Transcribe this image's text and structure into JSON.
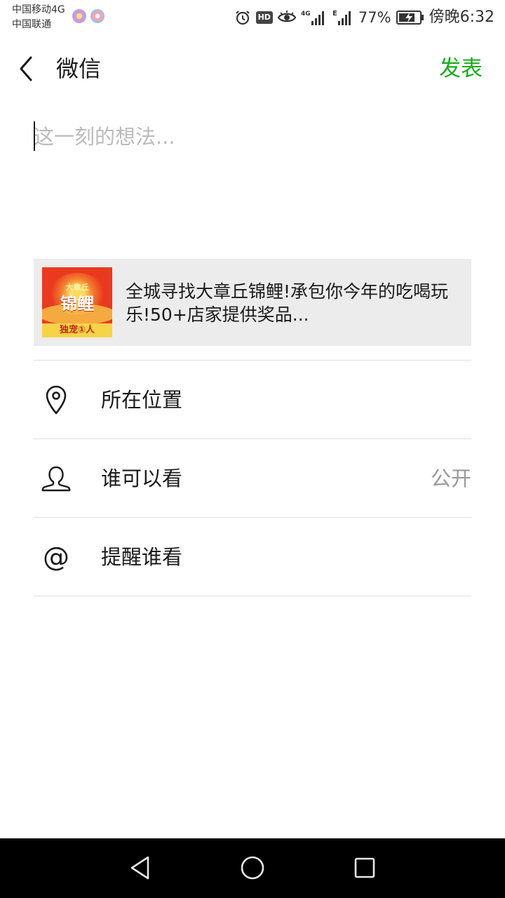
{
  "status_bar": {
    "carrier_line1": "中国移动4G",
    "carrier_line2": "中国联通",
    "hd_label": "HD",
    "net_4g": "4G",
    "net_e": "E",
    "battery": "77%",
    "time": "傍晚6:32"
  },
  "header": {
    "title": "微信",
    "publish_label": "发表"
  },
  "compose": {
    "placeholder": "这一刻的想法..."
  },
  "link_card": {
    "thumb_top": "大章丘",
    "thumb_main": "锦鲤",
    "thumb_bottom": "独宠①人",
    "text": "全城寻找大章丘锦鲤!承包你今年的吃喝玩乐!50+店家提供奖品..."
  },
  "options": {
    "location_label": "所在位置",
    "visibility_label": "谁可以看",
    "visibility_value": "公开",
    "mention_label": "提醒谁看"
  },
  "colors": {
    "accent_green": "#1aad19",
    "card_bg": "#ececec",
    "divider": "#e1e1e1"
  },
  "icons": [
    "back-icon",
    "location-pin-icon",
    "person-icon",
    "at-icon",
    "nav-back-icon",
    "nav-home-icon",
    "nav-recents-icon"
  ]
}
